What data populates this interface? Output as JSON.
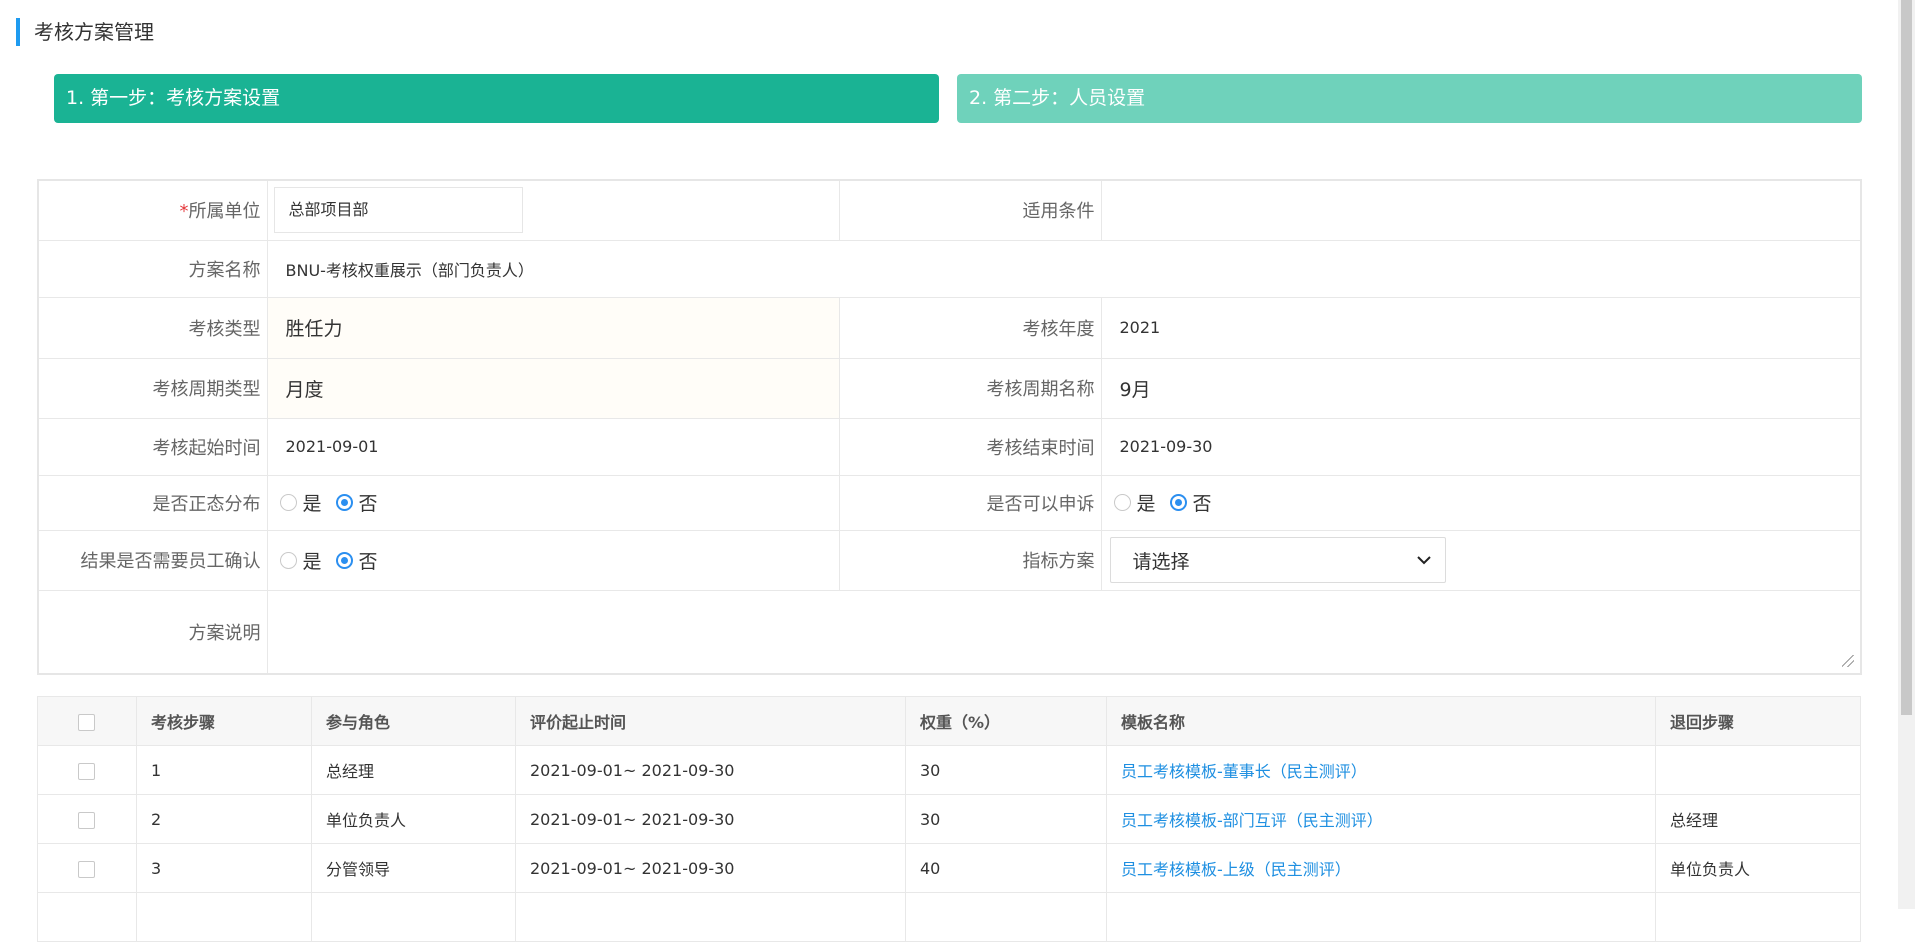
{
  "page": {
    "title": "考核方案管理"
  },
  "steps": [
    {
      "label": "1. 第一步：考核方案设置",
      "active": true
    },
    {
      "label": "2. 第二步：人员设置",
      "active": false
    }
  ],
  "form": {
    "unit_label": "所属单位",
    "unit_required_mark": "*",
    "unit_value": "总部项目部",
    "condition_label": "适用条件",
    "condition_value": "",
    "plan_name_label": "方案名称",
    "plan_name_value": "BNU-考核权重展示（部门负责人）",
    "type_label": "考核类型",
    "type_value": "胜任力",
    "year_label": "考核年度",
    "year_value": "2021",
    "cycle_type_label": "考核周期类型",
    "cycle_type_value": "月度",
    "cycle_name_label": "考核周期名称",
    "cycle_name_value": "9月",
    "start_label": "考核起始时间",
    "start_value": "2021-09-01",
    "end_label": "考核结束时间",
    "end_value": "2021-09-30",
    "normal_dist_label": "是否正态分布",
    "appeal_label": "是否可以申诉",
    "confirm_label": "结果是否需要员工确认",
    "radio_yes": "是",
    "radio_no": "否",
    "normal_dist_selected": "否",
    "appeal_selected": "否",
    "confirm_selected": "否",
    "indicator_label": "指标方案",
    "indicator_value": "请选择",
    "desc_label": "方案说明",
    "desc_value": ""
  },
  "table": {
    "headers": [
      "考核步骤",
      "参与角色",
      "评价起止时间",
      "权重（%）",
      "模板名称",
      "退回步骤"
    ],
    "rows": [
      {
        "step": "1",
        "role": "总经理",
        "period": "2021-09-01~ 2021-09-30",
        "weight": "30",
        "template": "员工考核模板-董事长（民主测评）",
        "back": ""
      },
      {
        "step": "2",
        "role": "单位负责人",
        "period": "2021-09-01~ 2021-09-30",
        "weight": "30",
        "template": "员工考核模板-部门互评（民主测评）",
        "back": "总经理"
      },
      {
        "step": "3",
        "role": "分管领导",
        "period": "2021-09-01~ 2021-09-30",
        "weight": "40",
        "template": "员工考核模板-上级（民主测评）",
        "back": "单位负责人"
      }
    ]
  },
  "icons": {
    "chevron": "chevron-down-icon"
  },
  "colors": {
    "step_active": "#1ab394",
    "step_inactive": "#6fd2bb",
    "accent": "#1e9bf0",
    "link": "#1e8fe1"
  }
}
